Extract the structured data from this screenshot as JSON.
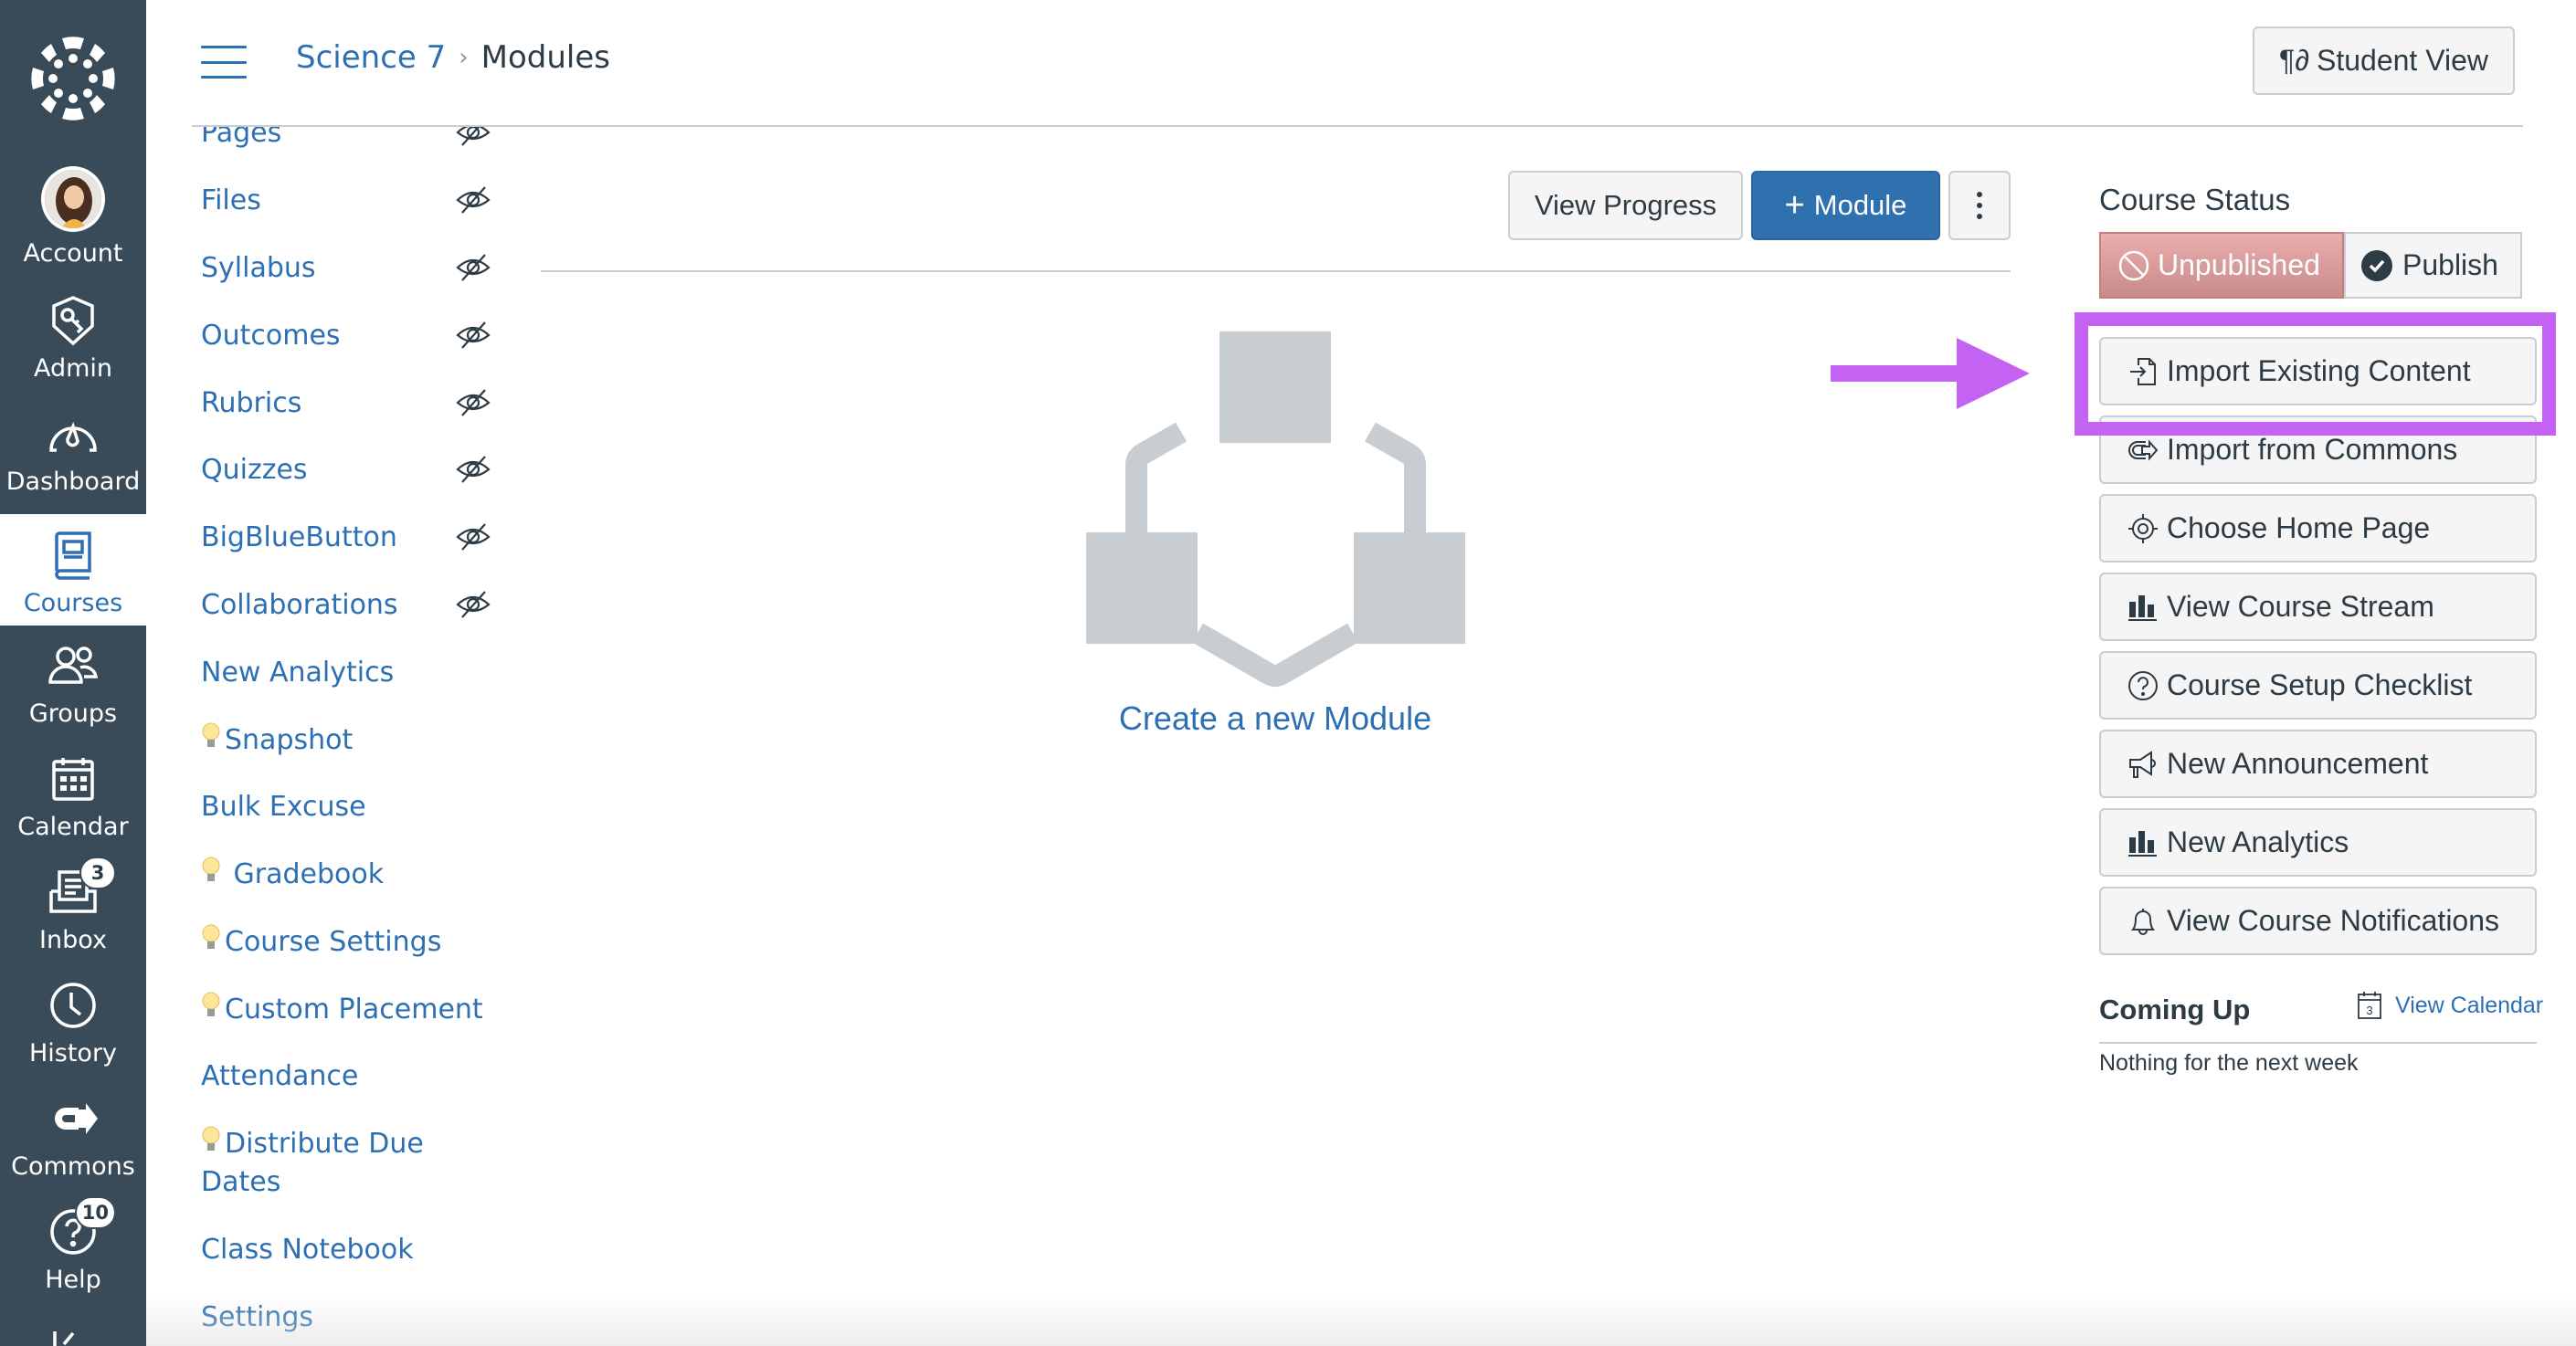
{
  "global_nav": {
    "logo": "canvas-logo",
    "items": [
      {
        "label": "Account",
        "icon": "avatar"
      },
      {
        "label": "Admin",
        "icon": "shield-key-icon"
      },
      {
        "label": "Dashboard",
        "icon": "dashboard-gauge-icon"
      },
      {
        "label": "Courses",
        "icon": "courses-book-icon",
        "active": true
      },
      {
        "label": "Groups",
        "icon": "groups-icon"
      },
      {
        "label": "Calendar",
        "icon": "calendar-icon"
      },
      {
        "label": "Inbox",
        "icon": "inbox-icon",
        "badge": "3"
      },
      {
        "label": "History",
        "icon": "clock-icon"
      },
      {
        "label": "Commons",
        "icon": "commons-icon"
      },
      {
        "label": "Help",
        "icon": "help-icon",
        "badge": "10"
      }
    ]
  },
  "header": {
    "breadcrumb": {
      "course": "Science 7",
      "separator": "›",
      "current": "Modules"
    },
    "student_view": "Student View"
  },
  "course_nav": {
    "items": [
      {
        "label": "Pages",
        "hidden": true
      },
      {
        "label": "Files",
        "hidden": true
      },
      {
        "label": "Syllabus",
        "hidden": true
      },
      {
        "label": "Outcomes",
        "hidden": true
      },
      {
        "label": "Rubrics",
        "hidden": true
      },
      {
        "label": "Quizzes",
        "hidden": true
      },
      {
        "label": "BigBlueButton",
        "hidden": true
      },
      {
        "label": "Collaborations",
        "hidden": true
      },
      {
        "label": "New Analytics"
      },
      {
        "label": "Snapshot",
        "bulb": true
      },
      {
        "label": "Bulk Excuse"
      },
      {
        "label": " Gradebook",
        "bulb": true
      },
      {
        "label": "Course Settings",
        "bulb": true
      },
      {
        "label": "Custom Placement",
        "bulb": true
      },
      {
        "label": "Attendance"
      },
      {
        "label": "Distribute Due",
        "label2": "Dates",
        "bulb": true
      },
      {
        "label": "Class Notebook"
      },
      {
        "label": "Settings"
      }
    ]
  },
  "toolbar": {
    "view_progress": "View Progress",
    "add_module_plus": "+",
    "add_module": "Module"
  },
  "empty_state": {
    "link": "Create a new Module"
  },
  "sidebar": {
    "course_status_label": "Course Status",
    "unpublished": "Unpublished",
    "publish": "Publish",
    "buttons": [
      {
        "label": "Import Existing Content",
        "icon": "import-icon"
      },
      {
        "label": "Import from Commons",
        "icon": "commons-icon"
      },
      {
        "label": "Choose Home Page",
        "icon": "target-icon"
      },
      {
        "label": "View Course Stream",
        "icon": "bar-chart-icon"
      },
      {
        "label": "Course Setup Checklist",
        "icon": "question-circle-icon"
      },
      {
        "label": "New Announcement",
        "icon": "megaphone-icon"
      },
      {
        "label": "New Analytics",
        "icon": "bar-chart-icon"
      },
      {
        "label": "View Course Notifications",
        "icon": "bell-icon"
      }
    ],
    "coming_up": "Coming Up",
    "view_calendar": "View Calendar",
    "calendar_day": "3",
    "nothing": "Nothing for the next week"
  },
  "annotation": {
    "highlight_color": "#c462f3",
    "target": "Import Existing Content"
  },
  "colors": {
    "nav_bg": "#394b58",
    "link": "#2d6fb3",
    "primary_button": "#2f70af",
    "unpublished": "#d99b9b"
  }
}
